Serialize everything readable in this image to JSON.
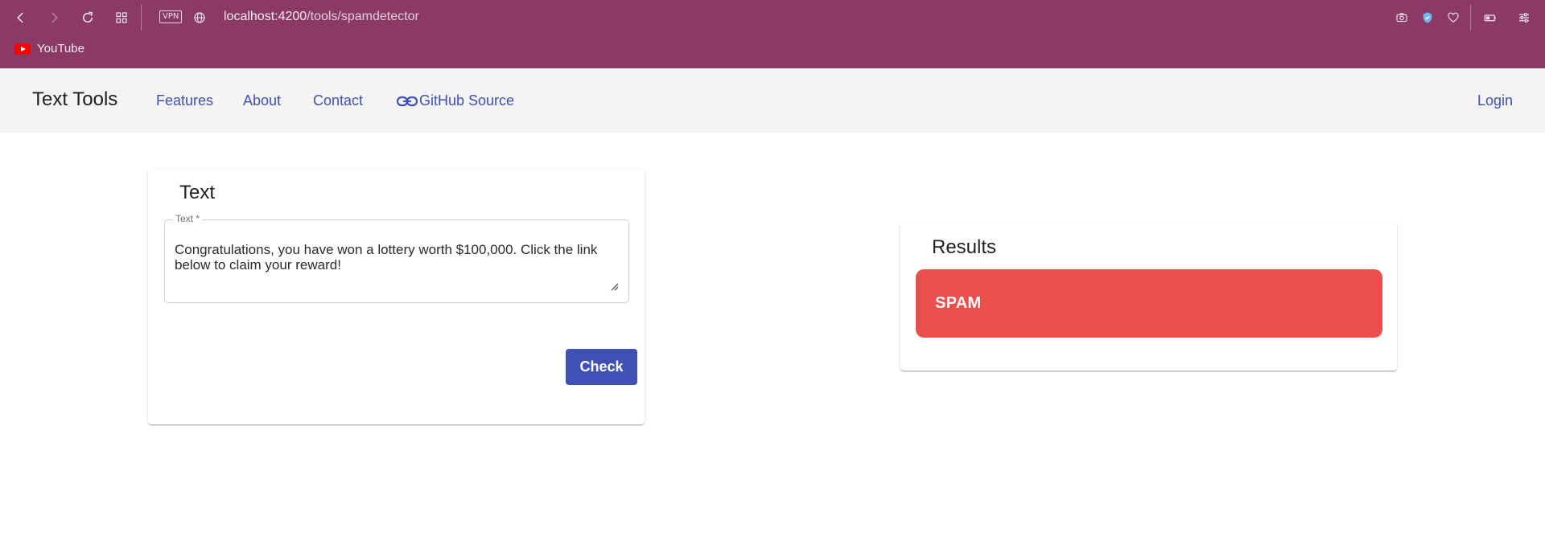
{
  "browser": {
    "url_host": "localhost:4200",
    "url_path": "/tools/spamdetector",
    "vpn_label": "VPN",
    "bookmark_label": "YouTube",
    "icons": [
      "back-icon",
      "forward-icon",
      "reload-icon",
      "tabs-grid-icon",
      "vpn-badge",
      "globe-icon",
      "camera-icon",
      "shield-check-icon",
      "heart-icon",
      "battery-icon",
      "settings-sliders-icon"
    ]
  },
  "toolbar": {
    "brand": "Text Tools",
    "nav": [
      "Features",
      "About",
      "Contact",
      "GitHub Source"
    ],
    "login": "Login",
    "link_icon": "link-icon"
  },
  "input_card": {
    "title": "Text",
    "field_label": "Text *",
    "field_value": "Congratulations, you have won a lottery worth $100,000. Click the link below to claim your reward!",
    "button": "Check"
  },
  "results_card": {
    "title": "Results",
    "result": "SPAM"
  },
  "colors": {
    "browser_bg": "#8b3a66",
    "primary": "#3f51b5",
    "spam": "#ea4f4c",
    "toolbar_bg": "#f4f4f4"
  }
}
